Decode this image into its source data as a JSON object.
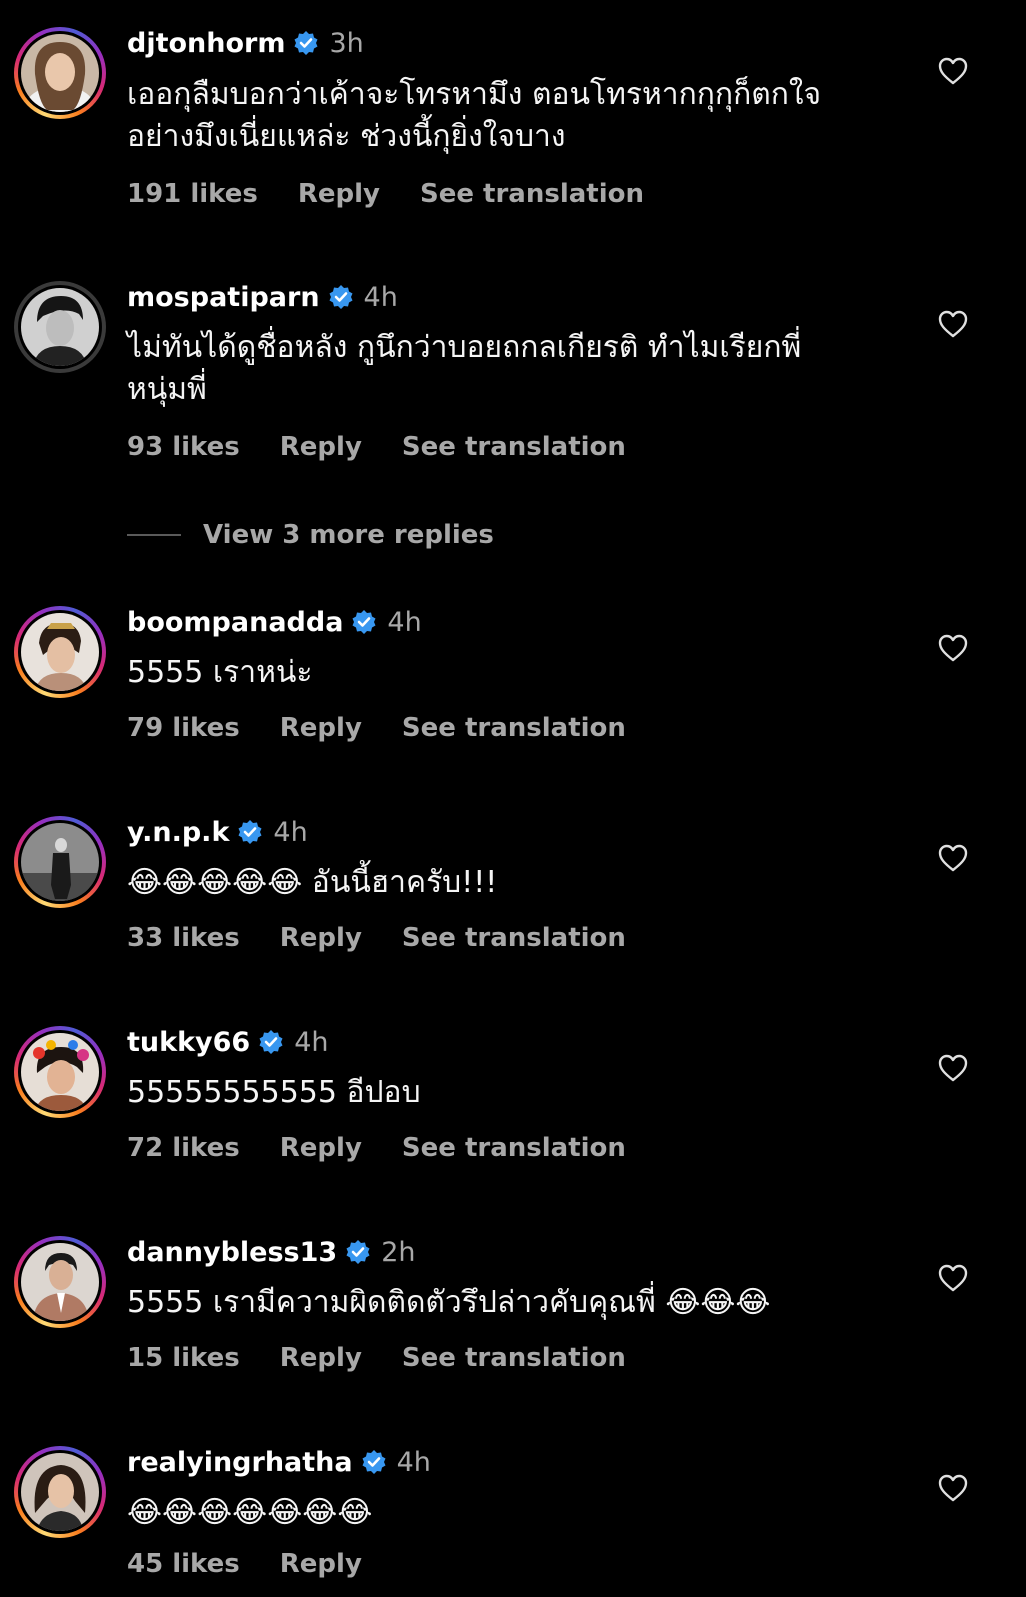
{
  "theme": {
    "background": "#000000",
    "text": "#f5f5f5",
    "muted": "#a8a8a8",
    "verified": "#3897f0"
  },
  "comments": [
    {
      "username": "djtonhorm",
      "time": "3h",
      "text_lines": [
        "เออกุลืมบอกว่าเค้าจะโทรหามึง ตอนโทรหากกุกุก็ตกใจ",
        "อย่างมึงเนี่ยแหล่ะ ช่วงนี้กุยิ่งใจบาง"
      ],
      "likes": "191 likes",
      "reply": "Reply",
      "translate": "See translation"
    },
    {
      "username": "mospatiparn",
      "time": "4h",
      "text_lines": [
        "ไม่ทันได้ดูชื่อหลัง กูนึกว่าบอยถกลเกียรติ ทำไมเรียกพี่",
        "หนุ่มพี่"
      ],
      "likes": "93 likes",
      "reply": "Reply",
      "translate": "See translation"
    },
    {
      "username": "boompanadda",
      "time": "4h",
      "text_lines": [
        "5555 เราหน่ะ"
      ],
      "likes": "79 likes",
      "reply": "Reply",
      "translate": "See translation"
    },
    {
      "username": "y.n.p.k",
      "time": "4h",
      "text_lines": [
        "😂😂😂😂😂 อันนี้ฮาครับ!!!"
      ],
      "likes": "33 likes",
      "reply": "Reply",
      "translate": "See translation"
    },
    {
      "username": "tukky66",
      "time": "4h",
      "text_lines": [
        "55555555555 อีปอบ"
      ],
      "likes": "72 likes",
      "reply": "Reply",
      "translate": "See translation"
    },
    {
      "username": "dannybless13",
      "time": "2h",
      "text_lines": [
        "5555 เรามีความผิดติดตัวรึปล่าวคับคุณพี่ 😂😂😂"
      ],
      "likes": "15 likes",
      "reply": "Reply",
      "translate": "See translation"
    },
    {
      "username": "realyingrhatha",
      "time": "4h",
      "text_lines": [
        "😂😂😂😂😂😂😂"
      ],
      "likes": "45 likes",
      "reply": "Reply"
    }
  ],
  "view_more_replies": "View 3 more replies"
}
